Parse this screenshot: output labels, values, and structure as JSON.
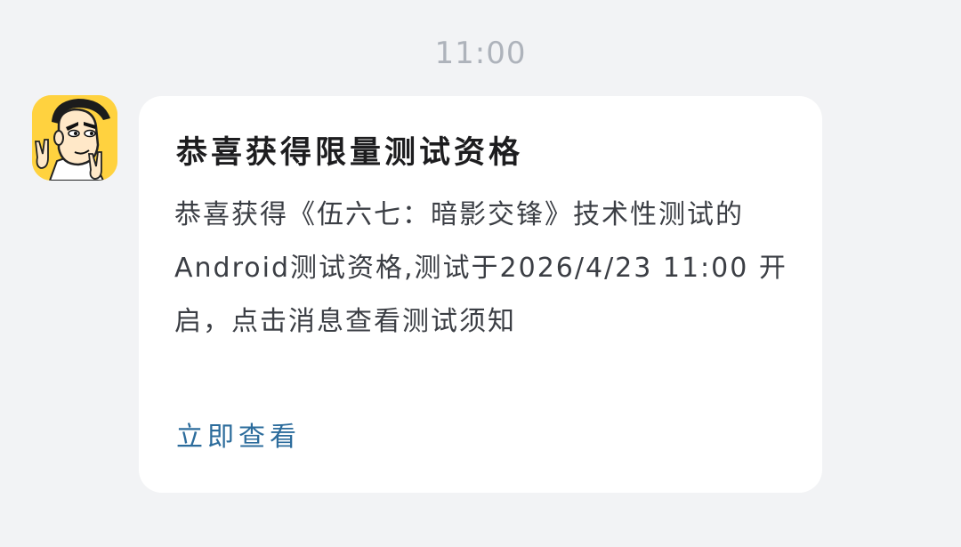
{
  "timestamp": "11:00",
  "sender": {
    "avatar_icon": "cartoon-character-peace-sign-avatar"
  },
  "message": {
    "title": "恭喜获得限量测试资格",
    "body": "恭喜获得《伍六七：暗影交锋》技术性测试的Android测试资格,测试于2026/4/23 11:00 开启，点击消息查看测试须知",
    "link_label": "立即查看"
  },
  "colors": {
    "background": "#f2f3f5",
    "card": "#ffffff",
    "link": "#2c6c9c",
    "timestamp": "#aeb3bb"
  }
}
